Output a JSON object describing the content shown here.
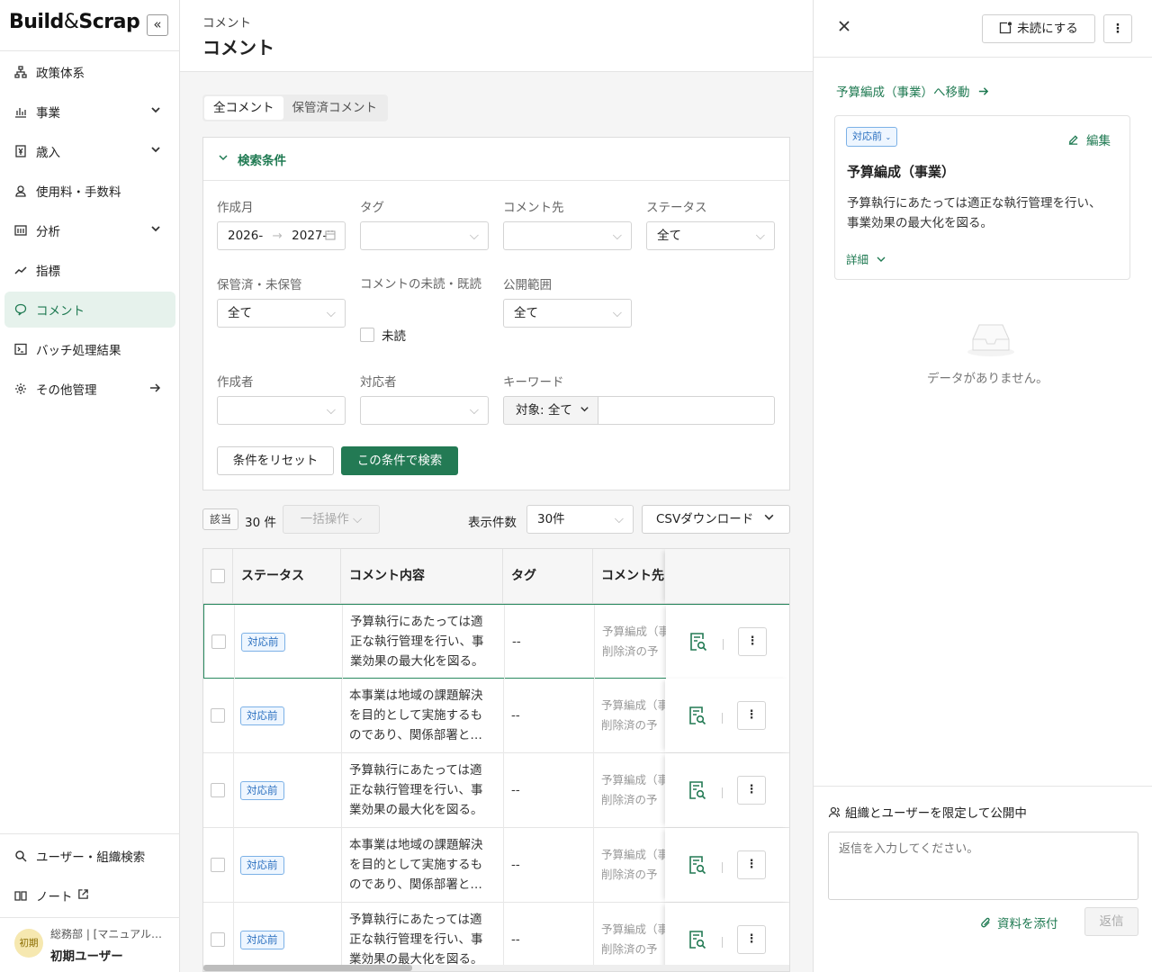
{
  "app": {
    "logo_build": "Build",
    "logo_amp": "&",
    "logo_scrap": "Scrap"
  },
  "sidebar": {
    "items": [
      {
        "label": "政策体系",
        "icon": "org-chart-icon"
      },
      {
        "label": "事業",
        "icon": "bar-chart-icon"
      },
      {
        "label": "歳入",
        "icon": "yen-receipt-icon"
      },
      {
        "label": "使用料・手数料",
        "icon": "coins-icon"
      },
      {
        "label": "分析",
        "icon": "analysis-icon"
      },
      {
        "label": "指標",
        "icon": "trend-icon"
      },
      {
        "label": "コメント",
        "icon": "comment-icon"
      },
      {
        "label": "バッチ処理結果",
        "icon": "terminal-icon"
      },
      {
        "label": "その他管理",
        "icon": "gear-icon"
      }
    ],
    "bottom": [
      {
        "label": "ユーザー・組織検索",
        "icon": "search-icon"
      },
      {
        "label": "ノート",
        "icon": "book-icon"
      }
    ],
    "user": {
      "avatar": "初期",
      "org": "総務部 | [マニュアル…",
      "name": "初期ユーザー"
    }
  },
  "header": {
    "breadcrumb": "コメント",
    "title": "コメント"
  },
  "tabs": [
    "全コメント",
    "保管済コメント"
  ],
  "search": {
    "title": "検索条件",
    "created_month_label": "作成月",
    "date_from": "2026-",
    "date_to": "2027-",
    "tag_label": "タグ",
    "target_label": "コメント先",
    "status_label": "ステータス",
    "status_value": "全て",
    "archived_label": "保管済・未保管",
    "archived_value": "全て",
    "read_label": "コメントの未読・既読",
    "unread_label": "未読",
    "scope_label": "公開範囲",
    "scope_value": "全て",
    "author_label": "作成者",
    "assignee_label": "対応者",
    "keyword_label": "キーワード",
    "keyword_target": "対象: 全て",
    "reset_label": "条件をリセット",
    "search_label": "この条件で検索"
  },
  "results": {
    "hit_label": "該当",
    "count": "30 件",
    "bulk_label": "一括操作",
    "per_page_label": "表示件数",
    "per_page_value": "30件",
    "csv_label": "CSVダウンロード"
  },
  "table": {
    "headers": [
      "ステータス",
      "コメント内容",
      "タグ",
      "コメント先"
    ],
    "rows": [
      {
        "status": "対応前",
        "content": [
          "予算執行にあたっては適",
          "正な執行管理を行い、事",
          "業効果の最大化を図る。"
        ],
        "tag": "--",
        "target": [
          "予算編成（事",
          "削除済の予"
        ]
      },
      {
        "status": "対応前",
        "content": [
          "本事業は地域の課題解決",
          "を目的として実施するも",
          "のであり、関係部署と…"
        ],
        "tag": "--",
        "target": [
          "予算編成（事",
          "削除済の予"
        ]
      },
      {
        "status": "対応前",
        "content": [
          "予算執行にあたっては適",
          "正な執行管理を行い、事",
          "業効果の最大化を図る。"
        ],
        "tag": "--",
        "target": [
          "予算編成（事",
          "削除済の予"
        ]
      },
      {
        "status": "対応前",
        "content": [
          "本事業は地域の課題解決",
          "を目的として実施するも",
          "のであり、関係部署と…"
        ],
        "tag": "--",
        "target": [
          "予算編成（事",
          "削除済の予"
        ]
      },
      {
        "status": "対応前",
        "content": [
          "予算執行にあたっては適",
          "正な執行管理を行い、事",
          "業効果の最大化を図る。"
        ],
        "tag": "--",
        "target": [
          "予算編成（事",
          "削除済の予"
        ]
      }
    ]
  },
  "panel": {
    "mark_unread": "未読にする",
    "move_link": "予算編成（事業）へ移動",
    "status": "対応前",
    "edit": "編集",
    "title": "予算編成（事業）",
    "body": [
      "予算執行にあたっては適正な執行管理を行い、",
      "事業効果の最大化を図る。"
    ],
    "detail": "詳細",
    "empty": "データがありません。",
    "visibility": "組織とユーザーを限定して公開中",
    "reply_placeholder": "返信を入力してください。",
    "attach": "資料を添付",
    "reply": "返信"
  },
  "colors": {
    "accent": "#237a54",
    "badge": "#2a6fbf"
  }
}
